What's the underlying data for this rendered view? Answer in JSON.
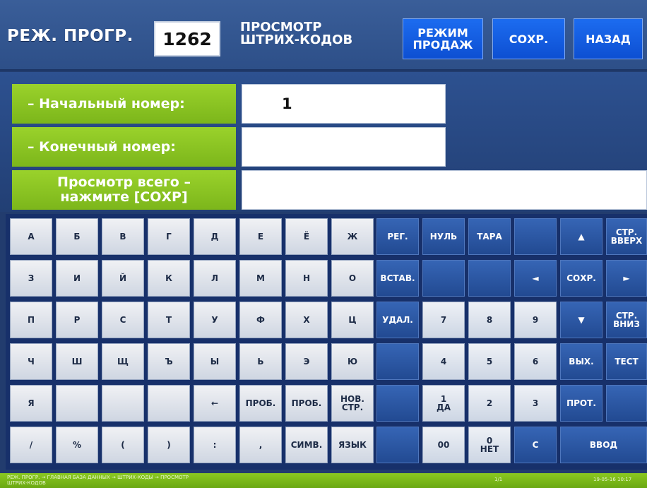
{
  "header": {
    "mode_title": "РЕЖ. ПРОГР.",
    "program_number": "1262",
    "screen_title_line1": "ПРОСМОТР",
    "screen_title_line2": "ШТРИХ-КОДОВ",
    "buttons": {
      "sales_mode_line1": "РЕЖИМ",
      "sales_mode_line2": "ПРОДАЖ",
      "save": "СОХР.",
      "back": "НАЗАД"
    }
  },
  "form": {
    "start_number_label": "– Начальный номер:",
    "start_number_value": "1",
    "end_number_label": "– Конечный номер:",
    "end_number_value": "",
    "view_all_line1": "Просмотр всего –",
    "view_all_line2": "нажмите [СОХР]",
    "view_all_value": ""
  },
  "keyboard": {
    "letters": [
      [
        "А",
        "Б",
        "В",
        "Г",
        "Д",
        "Е",
        "Ё",
        "Ж"
      ],
      [
        "З",
        "И",
        "Й",
        "К",
        "Л",
        "М",
        "Н",
        "О"
      ],
      [
        "П",
        "Р",
        "С",
        "Т",
        "У",
        "Ф",
        "Х",
        "Ц"
      ],
      [
        "Ч",
        "Ш",
        "Щ",
        "Ъ",
        "Ы",
        "Ь",
        "Э",
        "Ю"
      ],
      [
        "Я",
        "",
        "",
        "",
        "←",
        "ПРОБ.",
        "ПРОБ.",
        "НОВ. СТР."
      ],
      [
        "/",
        "%",
        "(",
        ")",
        ":",
        ",",
        "СИМВ.",
        "ЯЗЫК"
      ]
    ],
    "functions": {
      "reg": "РЕГ.",
      "null": "НУЛЬ",
      "tare": "ТАРА",
      "up": "▲",
      "page_up": "СТР. ВВЕРХ",
      "insert": "ВСТАВ.",
      "left": "◄",
      "save": "СОХР.",
      "right": "►",
      "delete": "УДАЛ.",
      "down": "▼",
      "page_down": "СТР. ВНИЗ",
      "exit": "ВЫХ.",
      "test": "ТЕСТ",
      "prot": "ПРОТ.",
      "clear": "С",
      "enter": "ВВОД"
    },
    "digits": {
      "d7": "7",
      "d8": "8",
      "d9": "9",
      "d4": "4",
      "d5": "5",
      "d6": "6",
      "d1": "1",
      "d1_sub": "ДА",
      "d2": "2",
      "d3": "3",
      "d00": "00",
      "d0": "0",
      "d0_sub": "НЕТ"
    }
  },
  "status_bar": {
    "path": "РЕЖ. ПРОГР. → ГЛАВНАЯ БАЗА ДАННЫХ → ШТРИХ-КОДЫ → ПРОСМОТР",
    "path_line2": "ШТРИХ-КОДОВ",
    "page": "1/1",
    "datetime": "19-05-16 10:17"
  },
  "colors": {
    "background": "#223c6e",
    "label_green": "#8bc920",
    "button_blue": "#1c6cf0"
  }
}
